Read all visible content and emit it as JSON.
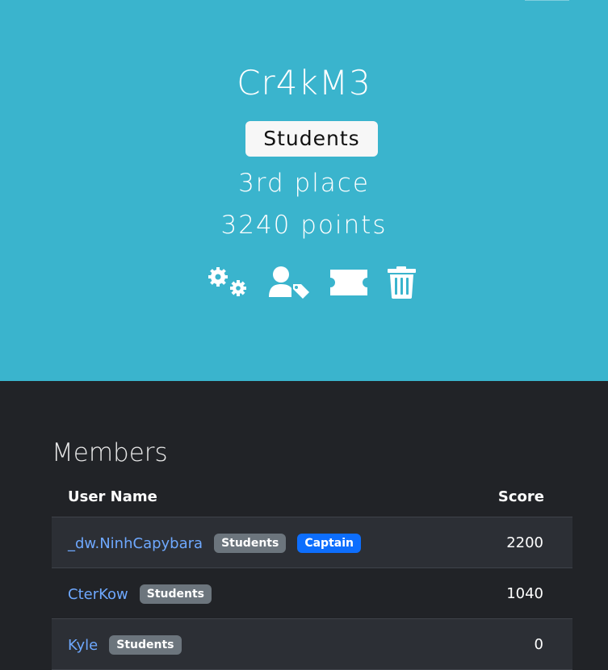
{
  "team": {
    "name": "Cr4kM3",
    "bracket": "Students",
    "place": "3rd place",
    "points": "3240 points"
  },
  "actions": [
    {
      "icon": "gears-icon",
      "label": "Settings"
    },
    {
      "icon": "user-tag-icon",
      "label": "Captain"
    },
    {
      "icon": "ticket-icon",
      "label": "Invite"
    },
    {
      "icon": "trash-icon",
      "label": "Delete"
    }
  ],
  "members": {
    "title": "Members",
    "columns": [
      "User Name",
      "Score"
    ],
    "rows": [
      {
        "name": "_dw.NinhCapybara",
        "badges": [
          "Students",
          "Captain"
        ],
        "score": "2200"
      },
      {
        "name": "CterKow",
        "badges": [
          "Students"
        ],
        "score": "1040"
      },
      {
        "name": "Kyle",
        "badges": [
          "Students"
        ],
        "score": "0"
      }
    ]
  },
  "colors": {
    "hero_bg": "#3ab4cd",
    "page_bg": "#212327",
    "link": "#6ea8fe",
    "badge_gray": "#6c757d",
    "badge_blue": "#0d6efd"
  }
}
